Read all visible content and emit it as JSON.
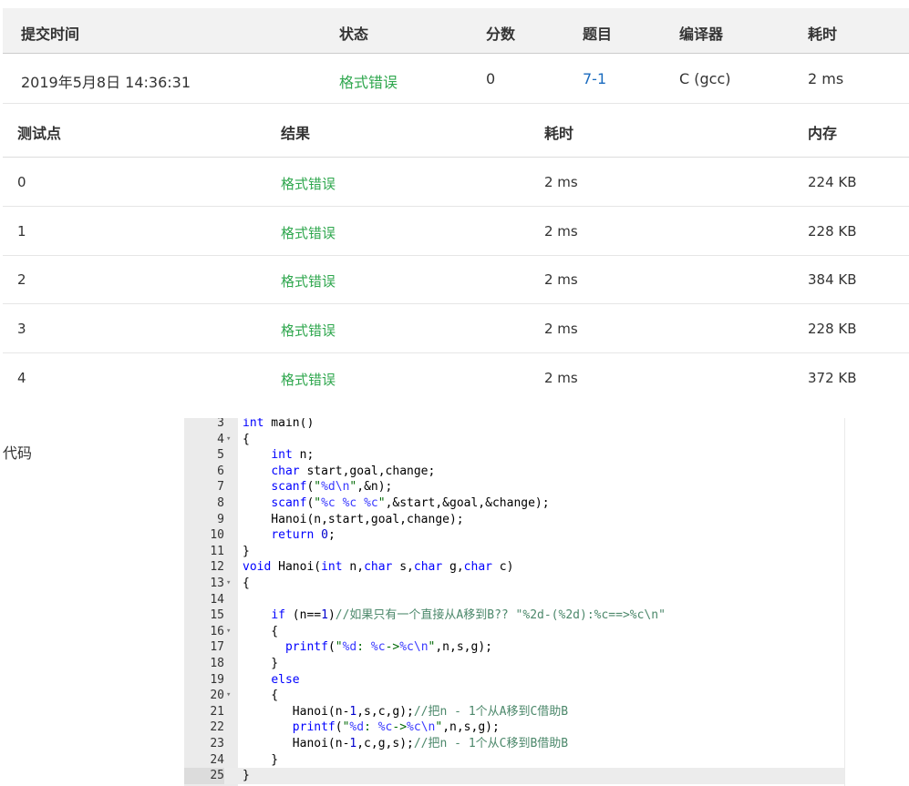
{
  "submission": {
    "headers": [
      "提交时间",
      "状态",
      "分数",
      "题目",
      "编译器",
      "耗时"
    ],
    "row": {
      "time": "2019年5月8日 14:36:31",
      "status": "格式错误",
      "score": "0",
      "problem": "7-1",
      "compiler": "C (gcc)",
      "elapsed": "2 ms"
    }
  },
  "testpoints": {
    "headers": [
      "测试点",
      "结果",
      "耗时",
      "内存"
    ],
    "rows": [
      {
        "id": "0",
        "result": "格式错误",
        "time": "2 ms",
        "memory": "224 KB"
      },
      {
        "id": "1",
        "result": "格式错误",
        "time": "2 ms",
        "memory": "228 KB"
      },
      {
        "id": "2",
        "result": "格式错误",
        "time": "2 ms",
        "memory": "384 KB"
      },
      {
        "id": "3",
        "result": "格式错误",
        "time": "2 ms",
        "memory": "228 KB"
      },
      {
        "id": "4",
        "result": "格式错误",
        "time": "2 ms",
        "memory": "372 KB"
      }
    ]
  },
  "code": {
    "label": "代码",
    "lines": [
      {
        "n": "3",
        "fold": false,
        "text": "int main()"
      },
      {
        "n": "4",
        "fold": true,
        "text": "{"
      },
      {
        "n": "5",
        "fold": false,
        "text": "    int n;"
      },
      {
        "n": "6",
        "fold": false,
        "text": "    char start,goal,change;"
      },
      {
        "n": "7",
        "fold": false,
        "text": "    scanf(\"%d\\n\",&n);"
      },
      {
        "n": "8",
        "fold": false,
        "text": "    scanf(\"%c %c %c\",&start,&goal,&change);"
      },
      {
        "n": "9",
        "fold": false,
        "text": "    Hanoi(n,start,goal,change);"
      },
      {
        "n": "10",
        "fold": false,
        "text": "    return 0;"
      },
      {
        "n": "11",
        "fold": false,
        "text": "}"
      },
      {
        "n": "12",
        "fold": false,
        "text": "void Hanoi(int n,char s,char g,char c)"
      },
      {
        "n": "13",
        "fold": true,
        "text": "{"
      },
      {
        "n": "14",
        "fold": false,
        "text": ""
      },
      {
        "n": "15",
        "fold": false,
        "text": "    if (n==1)//如果只有一个直接从A移到B?? \"%2d-(%2d):%c==>%c\\n\""
      },
      {
        "n": "16",
        "fold": true,
        "text": "    {"
      },
      {
        "n": "17",
        "fold": false,
        "text": "      printf(\"%d: %c->%c\\n\",n,s,g);"
      },
      {
        "n": "18",
        "fold": false,
        "text": "    }"
      },
      {
        "n": "19",
        "fold": false,
        "text": "    else"
      },
      {
        "n": "20",
        "fold": true,
        "text": "    {"
      },
      {
        "n": "21",
        "fold": false,
        "text": "       Hanoi(n-1,s,c,g);//把n - 1个从A移到C借助B"
      },
      {
        "n": "22",
        "fold": false,
        "text": "       printf(\"%d: %c->%c\\n\",n,s,g);"
      },
      {
        "n": "23",
        "fold": false,
        "text": "       Hanoi(n-1,c,g,s);//把n - 1个从C移到B借助B"
      },
      {
        "n": "24",
        "fold": false,
        "text": "    }"
      },
      {
        "n": "25",
        "fold": false,
        "text": "}"
      }
    ],
    "active_line": "25"
  }
}
